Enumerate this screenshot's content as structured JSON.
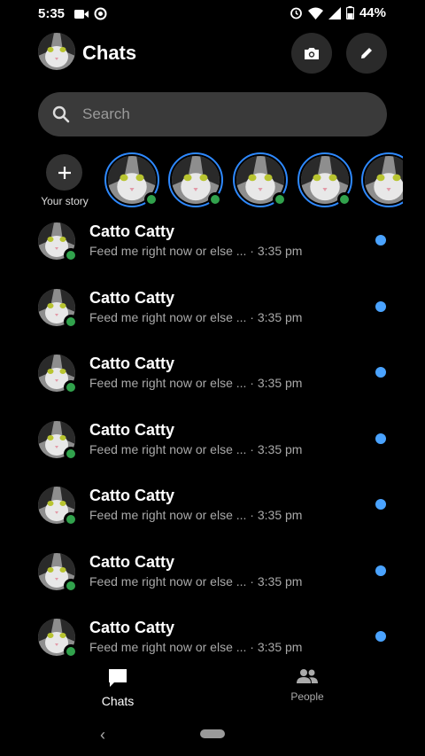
{
  "status_bar": {
    "time": "5:35",
    "battery": "44%",
    "icons": [
      "video-icon",
      "at-icon",
      "alarm-icon",
      "wifi-icon",
      "signal-icon",
      "battery-icon"
    ]
  },
  "header": {
    "title": "Chats",
    "camera_icon": "camera-icon",
    "compose_icon": "pencil-icon"
  },
  "search": {
    "placeholder": "Search"
  },
  "stories": {
    "your_story_label": "Your story",
    "count": 5
  },
  "chats": [
    {
      "name": "Catto Catty",
      "preview": "Feed me right now or else ... · 3:35 pm",
      "online": true,
      "unread": true
    },
    {
      "name": "Catto Catty",
      "preview": "Feed me right now or else ... · 3:35 pm",
      "online": true,
      "unread": true
    },
    {
      "name": "Catto Catty",
      "preview": "Feed me right now or else ... · 3:35 pm",
      "online": true,
      "unread": true
    },
    {
      "name": "Catto Catty",
      "preview": "Feed me right now or else ... · 3:35 pm",
      "online": true,
      "unread": true
    },
    {
      "name": "Catto Catty",
      "preview": "Feed me right now or else ... · 3:35 pm",
      "online": true,
      "unread": true
    },
    {
      "name": "Catto Catty",
      "preview": "Feed me right now or else ... · 3:35 pm",
      "online": true,
      "unread": true
    },
    {
      "name": "Catto Catty",
      "preview": "Feed me right now or else ... · 3:35 pm",
      "online": true,
      "unread": true
    }
  ],
  "bottom_nav": {
    "chats_label": "Chats",
    "people_label": "People"
  },
  "colors": {
    "accent": "#2e89ff",
    "online": "#31a24c",
    "unread": "#4aa3ff"
  }
}
